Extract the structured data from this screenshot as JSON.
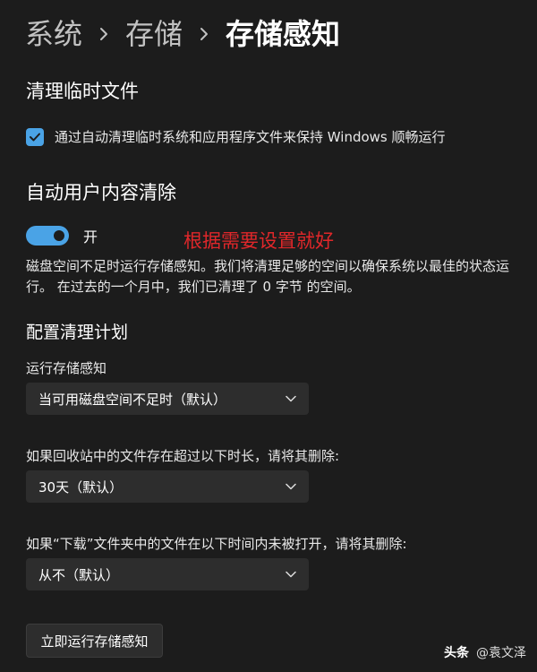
{
  "breadcrumb": {
    "root": "系统",
    "parent": "存储",
    "current": "存储感知"
  },
  "temp_files": {
    "heading": "清理临时文件",
    "checkbox_label": "通过自动清理临时系统和应用程序文件来保持 Windows 顺畅运行",
    "checked": true
  },
  "auto_cleanup": {
    "heading": "自动用户内容清除",
    "toggle_state": "开",
    "toggle_on": true,
    "annotation": "根据需要设置就好",
    "annotation_color": "#e0272a",
    "description": "磁盘空间不足时运行存储感知。我们将清理足够的空间以确保系统以最佳的状态运行。 在过去的一个月中，我们已清理了 0 字节 的空间。"
  },
  "schedule": {
    "heading": "配置清理计划",
    "run_label": "运行存储感知",
    "run_value": "当可用磁盘空间不足时（默认）",
    "recycle_label": "如果回收站中的文件存在超过以下时长，请将其删除:",
    "recycle_value": "30天（默认）",
    "downloads_label": "如果“下载”文件夹中的文件在以下时间内未被打开，请将其删除:",
    "downloads_value": "从不（默认）"
  },
  "actions": {
    "run_now_label": "立即运行存储感知"
  },
  "watermark": {
    "app": "头条",
    "author": "@袁文泽"
  },
  "colors": {
    "background": "#1c1c1c",
    "accent": "#4aa3e6",
    "control": "#2d2d2d"
  }
}
